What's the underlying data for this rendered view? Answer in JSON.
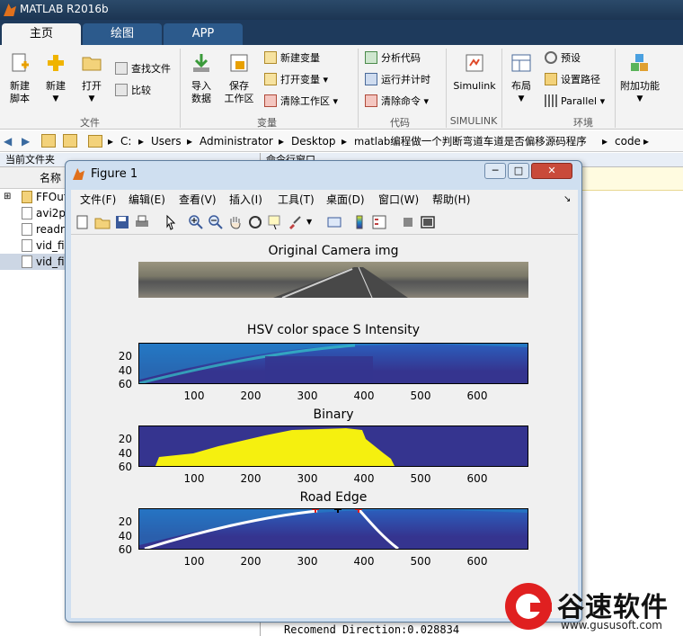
{
  "app": {
    "title": "MATLAB R2016b"
  },
  "tabs": [
    "主页",
    "绘图",
    "APP"
  ],
  "ribbon": {
    "new_script": "新建\n脚本",
    "new": "新建",
    "open": "打开",
    "find_files": "查找文件",
    "compare": "比较",
    "import_data": "导入\n数据",
    "save_workspace": "保存\n工作区",
    "new_variable": "新建变量",
    "open_variable": "打开变量",
    "clear_workspace": "清除工作区",
    "analyze_code": "分析代码",
    "run_and_time": "运行并计时",
    "clear_commands": "清除命令",
    "simulink": "Simulink",
    "layout": "布局",
    "preferences": "预设",
    "set_path": "设置路径",
    "parallel": "Parallel",
    "addons": "附加功能",
    "groups": {
      "file": "文件",
      "variable": "变量",
      "code": "代码",
      "simulink": "SIMULINK",
      "environment": "环境"
    }
  },
  "address": {
    "parts": [
      "C:",
      "Users",
      "Administrator",
      "Desktop",
      "matlab编程做一个判断弯道车道是否偏移源码程序",
      "code"
    ]
  },
  "current_folder": {
    "title": "当前文件夹",
    "column": "名称",
    "files": [
      {
        "name": "FFOut",
        "selected": false
      },
      {
        "name": "avi2p",
        "selected": false
      },
      {
        "name": "readr",
        "selected": false
      },
      {
        "name": "vid_fi",
        "selected": false
      },
      {
        "name": "vid_fi",
        "selected": true
      }
    ]
  },
  "command_window": {
    "title": "命令行窗口",
    "last_output": "Recomend Direction:0.028834"
  },
  "figure": {
    "title": "Figure 1",
    "menus": [
      "文件(F)",
      "编辑(E)",
      "查看(V)",
      "插入(I)",
      "工具(T)",
      "桌面(D)",
      "窗口(W)",
      "帮助(H)"
    ],
    "plots": [
      {
        "title": "Original Camera img"
      },
      {
        "title": "HSV color space S Intensity",
        "xticks": [
          "100",
          "200",
          "300",
          "400",
          "500",
          "600"
        ],
        "yticks": [
          "20",
          "40",
          "60"
        ]
      },
      {
        "title": "Binary",
        "xticks": [
          "100",
          "200",
          "300",
          "400",
          "500",
          "600"
        ],
        "yticks": [
          "20",
          "40",
          "60"
        ]
      },
      {
        "title": "Road Edge",
        "xticks": [
          "100",
          "200",
          "300",
          "400",
          "500",
          "600"
        ],
        "yticks": [
          "20",
          "40",
          "60"
        ]
      }
    ]
  },
  "watermark": {
    "name": "谷速软件",
    "url": "www.gususoft.com"
  },
  "colors": {
    "accent": "#1e3a5c",
    "parula_low": "#35348f",
    "parula_mid": "#1f8ac9",
    "binary_fg": "#f5f00f"
  }
}
